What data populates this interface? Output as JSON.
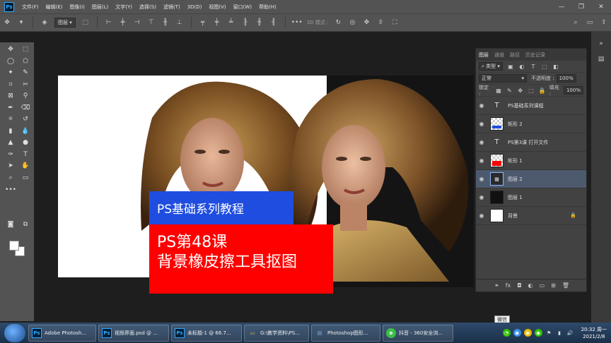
{
  "app": {
    "logo": "Ps"
  },
  "menu": [
    "文件(F)",
    "编辑(E)",
    "图像(I)",
    "图层(L)",
    "文字(Y)",
    "选择(S)",
    "滤镜(T)",
    "3D(D)",
    "视图(V)",
    "窗口(W)",
    "帮助(H)"
  ],
  "options": {
    "layer_select": "图层",
    "mode_3d": "3D 模式 :"
  },
  "canvas": {
    "blue_banner": "PS基础系列教程",
    "red_line1": "PS第48课",
    "red_line2": "背景橡皮擦工具抠图"
  },
  "layers_panel": {
    "tabs": [
      "图层",
      "通道",
      "路径",
      "历史记录"
    ],
    "filter": "类型",
    "blend_mode": "正常",
    "opacity_label": "不透明度 :",
    "opacity_value": "100%",
    "lock_label": "锁定 :",
    "fill_label": "填充 :",
    "fill_value": "100%",
    "layers": [
      {
        "name": "PS基础系列课程",
        "kind": "text"
      },
      {
        "name": "矩形 2",
        "kind": "shape-blue"
      },
      {
        "name": "PS第3课 打开文件",
        "kind": "text"
      },
      {
        "name": "矩形 1",
        "kind": "shape-red"
      },
      {
        "name": "图层 2",
        "kind": "pixel",
        "selected": true
      },
      {
        "name": "图层 1",
        "kind": "dark"
      },
      {
        "name": "背景",
        "kind": "white",
        "locked": true
      }
    ]
  },
  "taskbar": {
    "tasks": [
      {
        "label": "Adobe Photosh...",
        "icon": "Ps",
        "color": "#31a8ff"
      },
      {
        "label": "视频界面.psd @ ...",
        "icon": "Ps",
        "color": "#31a8ff"
      },
      {
        "label": "未标题-1 @ 66.7...",
        "icon": "Ps",
        "color": "#31a8ff"
      },
      {
        "label": "G:\\教学资料\\PS...",
        "icon": "▭",
        "color": "#f3c744"
      },
      {
        "label": "Photoshop图形...",
        "icon": "▤",
        "color": "#7fb2e8"
      },
      {
        "label": "抖音 - 360安全浏...",
        "icon": "e",
        "color": "#3cbf48"
      }
    ],
    "tooltip": "微信",
    "time": "20:32 周一",
    "date": "2021/2/8"
  }
}
